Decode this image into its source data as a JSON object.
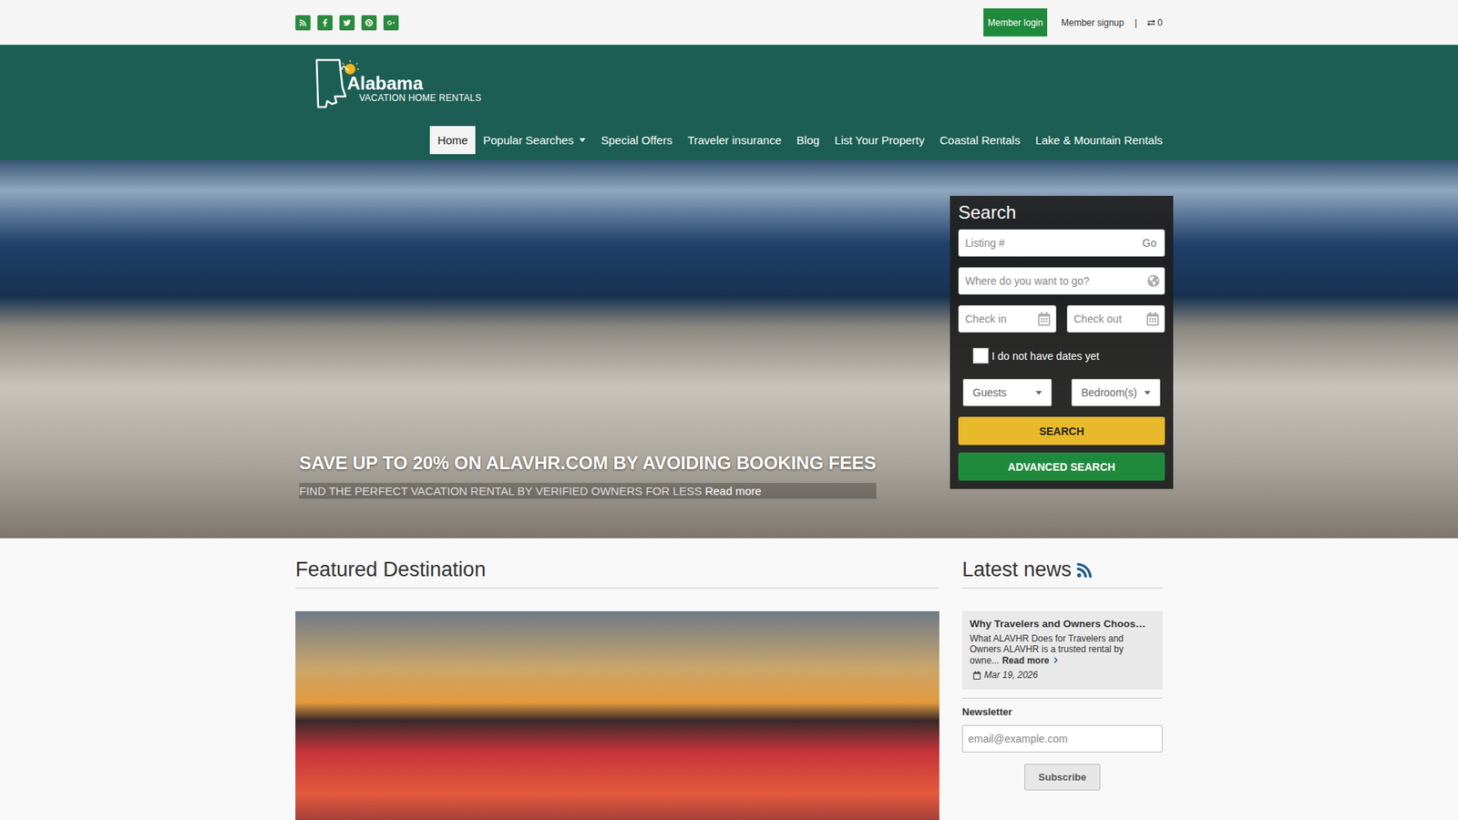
{
  "topbar": {
    "login": "Member login",
    "signup": "Member signup",
    "separator": "|",
    "compare_count": "0"
  },
  "logo": {
    "name": "Alabama",
    "tagline": "VACATION HOME RENTALS"
  },
  "nav": [
    {
      "label": "Home",
      "selected": true,
      "dropdown": false
    },
    {
      "label": "Popular Searches",
      "selected": false,
      "dropdown": true
    },
    {
      "label": "Special Offers",
      "selected": false,
      "dropdown": false
    },
    {
      "label": "Traveler insurance",
      "selected": false,
      "dropdown": false
    },
    {
      "label": "Blog",
      "selected": false,
      "dropdown": false
    },
    {
      "label": "List Your Property",
      "selected": false,
      "dropdown": false
    },
    {
      "label": "Coastal Rentals",
      "selected": false,
      "dropdown": false
    },
    {
      "label": "Lake & Mountain Rentals",
      "selected": false,
      "dropdown": false
    }
  ],
  "hero": {
    "title": "SAVE UP TO 20% ON ALAVHR.COM BY AVOIDING BOOKING FEES",
    "subtitle": "FIND THE PERFECT VACATION RENTAL BY VERIFIED OWNERS FOR LESS",
    "link": "Read more"
  },
  "search": {
    "title": "Search",
    "listing_placeholder": "Listing #",
    "go": "Go",
    "where_placeholder": "Where do you want to go?",
    "checkin_placeholder": "Check in",
    "checkout_placeholder": "Check out",
    "no_dates": {
      "label": "I do not have dates yet",
      "checked": false
    },
    "guests": "Guests",
    "bedrooms": "Bedroom(s)",
    "search_button": "SEARCH",
    "advanced_button": "ADVANCED SEARCH"
  },
  "featured": {
    "title": "Featured Destination"
  },
  "news": {
    "title": "Latest news",
    "items": [
      {
        "title": "Why Travelers and Owners Choos…",
        "excerpt": "What ALAVHR Does for Travelers and Owners ALAVHR is a trusted  rental by owne...",
        "link": "Read more",
        "date": "Mar 19, 2026"
      }
    ]
  },
  "newsletter": {
    "title": "Newsletter",
    "placeholder": "email@example.com",
    "button": "Subscribe"
  }
}
